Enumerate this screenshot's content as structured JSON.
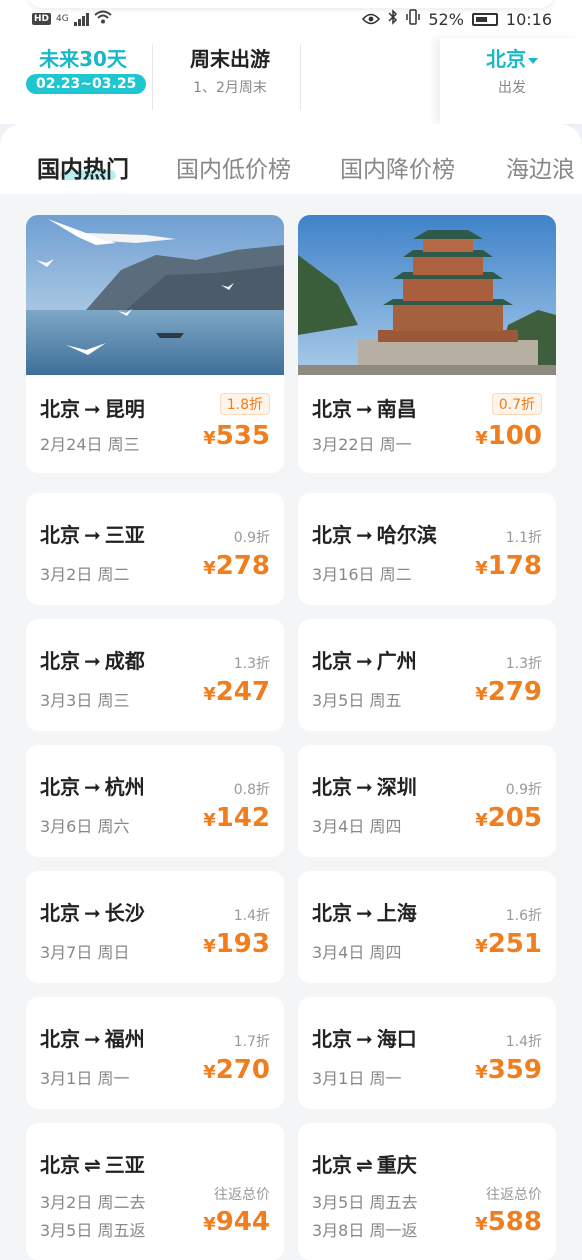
{
  "status_bar": {
    "hd": "HD",
    "network": "4G",
    "battery": "52%",
    "time": "10:16"
  },
  "filters": {
    "future": {
      "title": "未来30天",
      "range": "02.23~03.25"
    },
    "weekend": {
      "title": "周末出游",
      "subtitle": "1、2月周末"
    },
    "city": {
      "name": "北京",
      "subtitle": "出发"
    }
  },
  "tabs": [
    {
      "label": "国内热门",
      "active": true
    },
    {
      "label": "国内低价榜",
      "active": false
    },
    {
      "label": "国内降价榜",
      "active": false
    },
    {
      "label": "海边浪",
      "active": false
    }
  ],
  "colors": {
    "accent": "#18b8c6",
    "price": "#f07d1e",
    "badge_bg": "#fff4ea"
  },
  "arrow_oneway": "➞",
  "arrow_roundtrip": "⇌",
  "currency": "¥",
  "featured": [
    {
      "from": "北京",
      "to": "昆明",
      "date": "2月24日 周三",
      "discount": "1.8折",
      "price": "535",
      "image": "lake-seagulls"
    },
    {
      "from": "北京",
      "to": "南昌",
      "date": "3月22日 周一",
      "discount": "0.7折",
      "price": "100",
      "image": "pavilion-tower"
    }
  ],
  "flights": [
    {
      "from": "北京",
      "to": "三亚",
      "date": "3月2日 周二",
      "discount": "0.9折",
      "price": "278"
    },
    {
      "from": "北京",
      "to": "哈尔滨",
      "date": "3月16日 周二",
      "discount": "1.1折",
      "price": "178"
    },
    {
      "from": "北京",
      "to": "成都",
      "date": "3月3日 周三",
      "discount": "1.3折",
      "price": "247"
    },
    {
      "from": "北京",
      "to": "广州",
      "date": "3月5日 周五",
      "discount": "1.3折",
      "price": "279"
    },
    {
      "from": "北京",
      "to": "杭州",
      "date": "3月6日 周六",
      "discount": "0.8折",
      "price": "142"
    },
    {
      "from": "北京",
      "to": "深圳",
      "date": "3月4日 周四",
      "discount": "0.9折",
      "price": "205"
    },
    {
      "from": "北京",
      "to": "长沙",
      "date": "3月7日 周日",
      "discount": "1.4折",
      "price": "193"
    },
    {
      "from": "北京",
      "to": "上海",
      "date": "3月4日 周四",
      "discount": "1.6折",
      "price": "251"
    },
    {
      "from": "北京",
      "to": "福州",
      "date": "3月1日 周一",
      "discount": "1.7折",
      "price": "270"
    },
    {
      "from": "北京",
      "to": "海口",
      "date": "3月1日 周一",
      "discount": "1.4折",
      "price": "359"
    }
  ],
  "round_trips": [
    {
      "from": "北京",
      "to": "三亚",
      "depart": "3月2日 周二去",
      "return": "3月5日 周五返",
      "label": "往返总价",
      "price": "944"
    },
    {
      "from": "北京",
      "to": "重庆",
      "depart": "3月5日 周五去",
      "return": "3月8日 周一返",
      "label": "往返总价",
      "price": "588"
    }
  ]
}
